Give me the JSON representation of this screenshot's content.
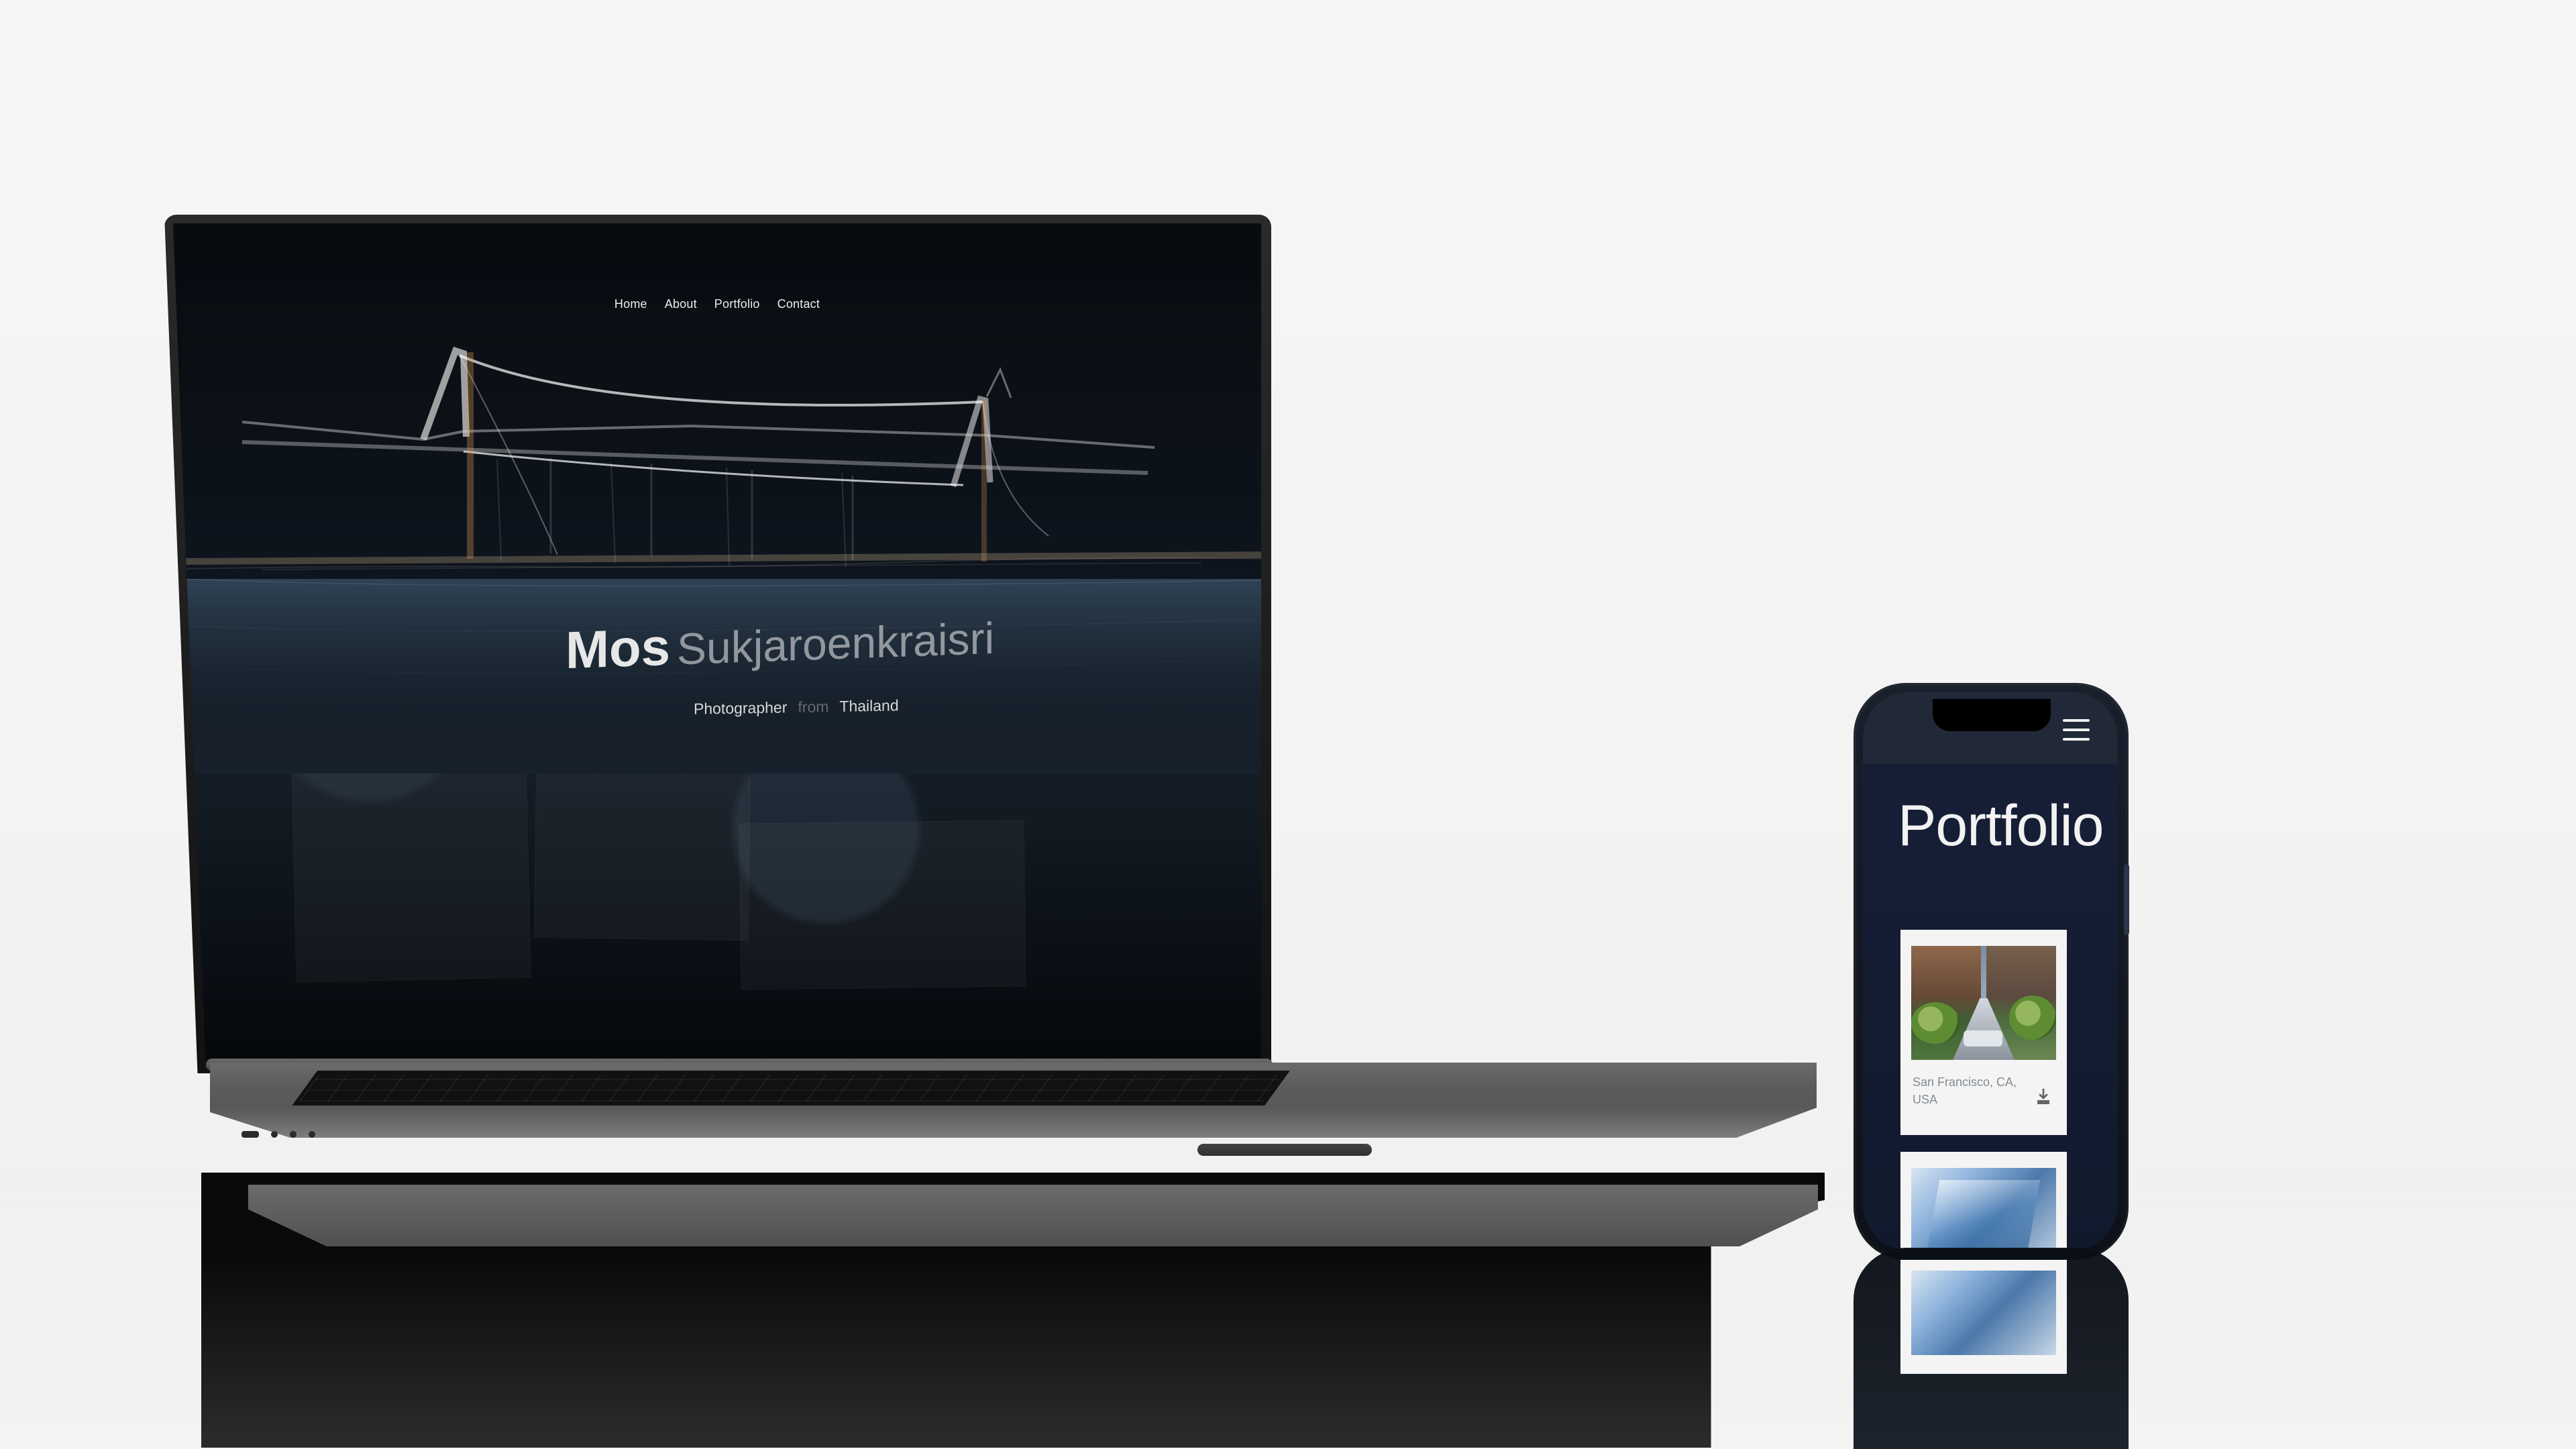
{
  "laptop_site": {
    "nav": [
      "Home",
      "About",
      "Portfolio",
      "Contact"
    ],
    "hero": {
      "first_name": "Mos",
      "last_name": "Sukjaroenkraisri",
      "subtitle_left": "Photographer",
      "subtitle_middle": "from",
      "subtitle_right": "Thailand"
    }
  },
  "phone_site": {
    "title": "Portfolio",
    "cards": [
      {
        "caption": "San Francisco, CA, USA",
        "icon": "download-icon"
      },
      {
        "caption": ""
      }
    ],
    "menu_icon": "hamburger-menu-icon"
  },
  "colors": {
    "page_bg": "#f4f4f4",
    "laptop_screen": "#090d12",
    "phone_screen": "#172038",
    "phone_card": "#f4f4f4",
    "text_light": "#f0f0f0",
    "text_muted": "#848b93"
  }
}
